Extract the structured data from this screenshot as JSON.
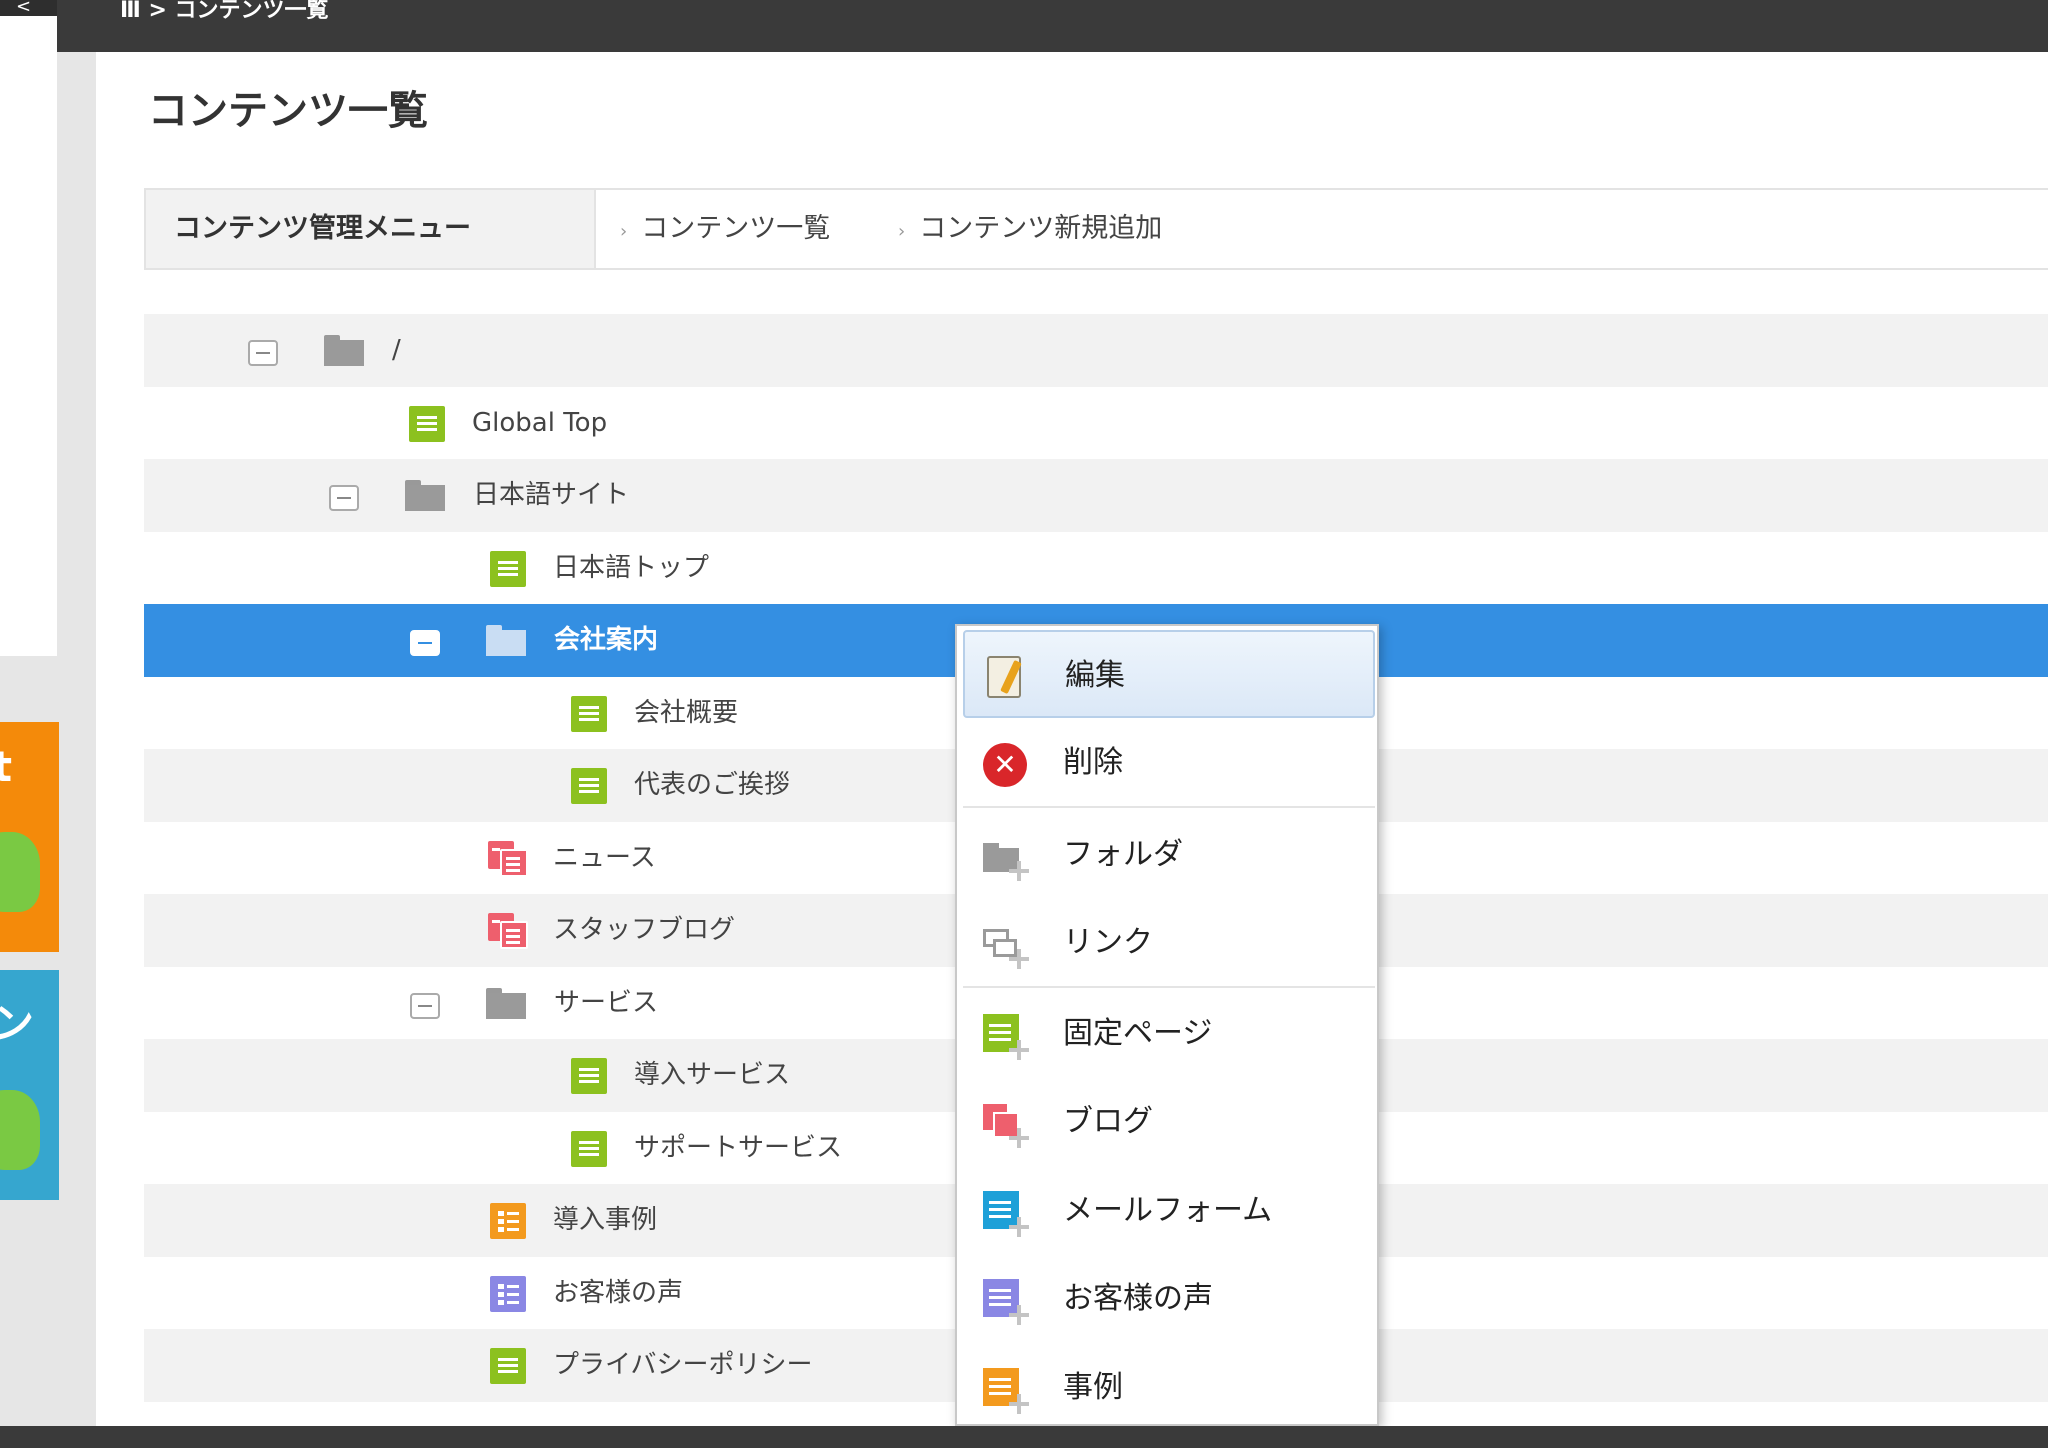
{
  "topbar": {
    "back_label": "<",
    "title": "Ⅲ > コンテンツ一覧"
  },
  "page_title": "コンテンツ一覧",
  "menu": {
    "head": "コンテンツ管理メニュー",
    "links": [
      "コンテンツ一覧",
      "コンテンツ新規追加"
    ]
  },
  "tree": [
    {
      "label": "/",
      "type": "folder",
      "icon": "folder-icon",
      "toggle": true
    },
    {
      "label": "Global Top",
      "type": "page",
      "icon": "page-icon",
      "color": "#8cc11f"
    },
    {
      "label": "日本語サイト",
      "type": "folder",
      "icon": "folder-icon",
      "toggle": true
    },
    {
      "label": "日本語トップ",
      "type": "page",
      "icon": "page-icon",
      "color": "#8cc11f"
    },
    {
      "label": "会社案内",
      "type": "folder",
      "icon": "folder-icon",
      "toggle": true,
      "selected": true
    },
    {
      "label": "会社概要",
      "type": "page",
      "icon": "page-icon",
      "color": "#8cc11f"
    },
    {
      "label": "代表のご挨拶",
      "type": "page",
      "icon": "page-icon",
      "color": "#8cc11f"
    },
    {
      "label": "ニュース",
      "type": "blog",
      "icon": "blog-icon",
      "color": "#ee5f6d"
    },
    {
      "label": "スタッフブログ",
      "type": "blog",
      "icon": "blog-icon",
      "color": "#ee5f6d"
    },
    {
      "label": "サービス",
      "type": "folder",
      "icon": "folder-icon",
      "toggle": true
    },
    {
      "label": "導入サービス",
      "type": "page",
      "icon": "page-icon",
      "color": "#8cc11f"
    },
    {
      "label": "サポートサービス",
      "type": "page",
      "icon": "page-icon",
      "color": "#8cc11f"
    },
    {
      "label": "導入事例",
      "type": "list",
      "icon": "case-list-icon",
      "color": "#f39a1e"
    },
    {
      "label": "お客様の声",
      "type": "list",
      "icon": "voice-list-icon",
      "color": "#8a87e4"
    },
    {
      "label": "プライバシーポリシー",
      "type": "page",
      "icon": "page-icon",
      "color": "#8cc11f"
    }
  ],
  "context_menu": {
    "items": [
      {
        "label": "編集",
        "icon": "edit-icon"
      },
      {
        "label": "削除",
        "icon": "delete-icon",
        "color": "#d9262a"
      },
      {
        "label": "フォルダ",
        "icon": "add-folder-icon"
      },
      {
        "label": "リンク",
        "icon": "add-link-icon"
      },
      {
        "label": "固定ページ",
        "icon": "add-page-icon",
        "color": "#8cc11f"
      },
      {
        "label": "ブログ",
        "icon": "add-blog-icon",
        "color": "#ee5f6d"
      },
      {
        "label": "メールフォーム",
        "icon": "add-mailform-icon",
        "color": "#1ea0d8"
      },
      {
        "label": "お客様の声",
        "icon": "add-voice-icon",
        "color": "#8a87e4"
      },
      {
        "label": "事例",
        "icon": "add-case-icon",
        "color": "#f39a1e"
      }
    ]
  }
}
